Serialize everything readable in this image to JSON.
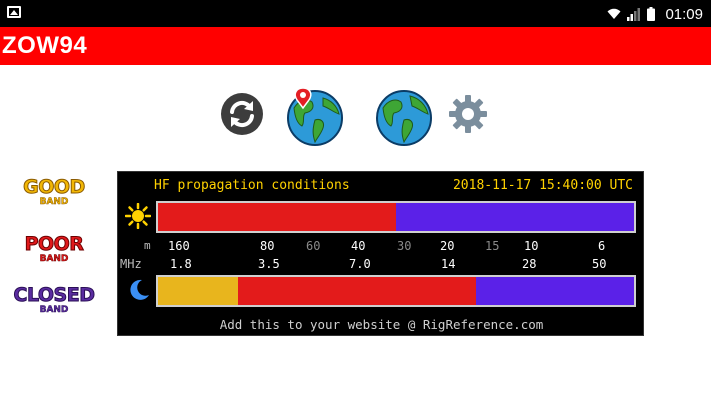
{
  "status_bar": {
    "time": "01:09"
  },
  "app_bar": {
    "title": "ZOW94"
  },
  "toolbar": {
    "icons": [
      "refresh-icon",
      "globe-pin-icon",
      "globe-icon",
      "gear-icon"
    ]
  },
  "legend": {
    "good": {
      "word": "GOOD",
      "sub": "BAND",
      "color": "#f2b705"
    },
    "poor": {
      "word": "POOR",
      "sub": "BAND",
      "color": "#e0191b"
    },
    "closed": {
      "word": "CLOSED",
      "sub": "BAND",
      "color": "#5a2ca0"
    }
  },
  "widget": {
    "heading": "HF propagation conditions",
    "datetime": "2018-11-17 15:40:00 UTC",
    "meters_label": "m",
    "mhz_label": "MHz",
    "meters": [
      "160",
      "80",
      "60",
      "40",
      "30",
      "20",
      "15",
      "10",
      "6"
    ],
    "mhz": [
      "1.8",
      "3.5",
      "7.0",
      "14",
      "28",
      "50"
    ],
    "day_bar": [
      {
        "state": "poor",
        "fraction": 0.5,
        "color": "#e31b1b"
      },
      {
        "state": "closed",
        "fraction": 0.5,
        "color": "#5b21e8"
      }
    ],
    "night_bar": [
      {
        "state": "good",
        "fraction": 0.168,
        "color": "#e8b51d"
      },
      {
        "state": "poor",
        "fraction": 0.5,
        "color": "#e31b1b"
      },
      {
        "state": "closed",
        "fraction": 0.332,
        "color": "#5b21e8"
      }
    ],
    "footer": "Add this to your website @ RigReference.com"
  }
}
